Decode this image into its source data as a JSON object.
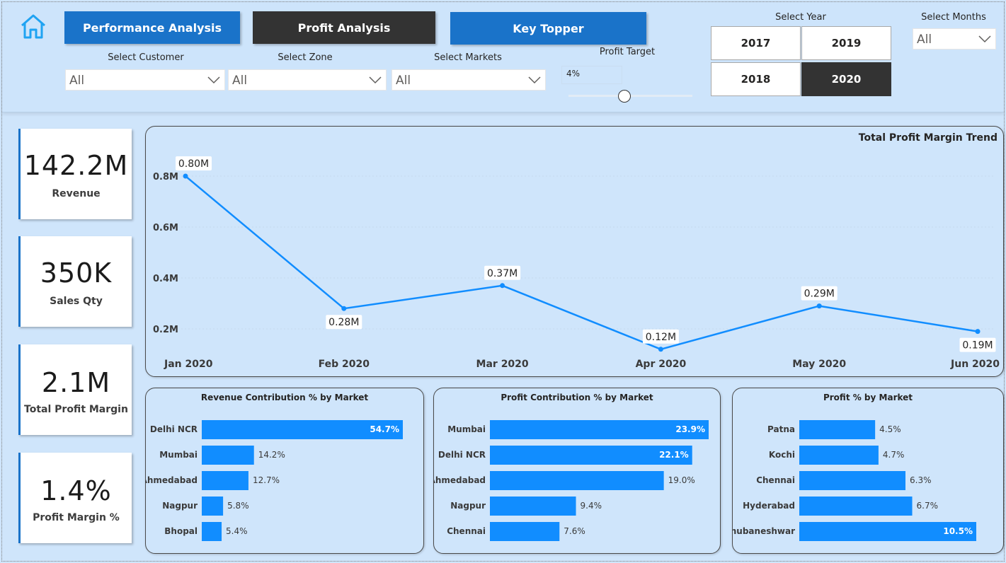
{
  "nav": {
    "performance_label": "Performance Analysis",
    "profit_label": "Profit Analysis",
    "topper_label": "Key Topper"
  },
  "filters": {
    "customer": {
      "label": "Select Customer",
      "value": "All"
    },
    "zone": {
      "label": "Select Zone",
      "value": "All"
    },
    "markets": {
      "label": "Select Markets",
      "value": "All"
    },
    "months": {
      "label": "Select Months",
      "value": "All"
    },
    "profit_target": {
      "label": "Profit Target",
      "value": "4%",
      "fraction": 0.45
    },
    "year": {
      "label": "Select Year",
      "options": [
        "2017",
        "2019",
        "2018",
        "2020"
      ],
      "selected": "2020"
    }
  },
  "kpis": [
    {
      "value": "142.2M",
      "label": "Revenue"
    },
    {
      "value": "350K",
      "label": "Sales Qty"
    },
    {
      "value": "2.1M",
      "label": "Total Profit Margin"
    },
    {
      "value": "1.4%",
      "label": "Profit Margin %"
    }
  ],
  "colors": {
    "accent": "#118dff",
    "nav_blue": "#1a73c9",
    "dark": "#333333",
    "background": "#cfe5fb"
  },
  "icons": {
    "home": "home-icon",
    "dropdown": "chevron-down-icon"
  },
  "chart_data": [
    {
      "type": "line",
      "title": "Total Profit Margin Trend",
      "x": [
        "Jan 2020",
        "Feb 2020",
        "Mar 2020",
        "Apr 2020",
        "May 2020",
        "Jun 2020"
      ],
      "values": [
        0.8,
        0.28,
        0.37,
        0.12,
        0.29,
        0.19
      ],
      "labels": [
        "0.80M",
        "0.28M",
        "0.37M",
        "0.12M",
        "0.29M",
        "0.19M"
      ],
      "yticks": [
        0.2,
        0.4,
        0.6,
        0.8
      ],
      "ytick_labels": [
        "0.2M",
        "0.4M",
        "0.6M",
        "0.8M"
      ],
      "ylim": [
        0.12,
        0.8
      ]
    },
    {
      "type": "bar",
      "title": "Revenue Contribution % by Market",
      "categories": [
        "Delhi NCR",
        "Mumbai",
        "Ahmedabad",
        "Nagpur",
        "Bhopal"
      ],
      "values": [
        54.7,
        14.2,
        12.7,
        5.8,
        5.4
      ],
      "labels": [
        "54.7%",
        "14.2%",
        "12.7%",
        "5.8%",
        "5.4%"
      ]
    },
    {
      "type": "bar",
      "title": "Profit Contribution % by Market",
      "categories": [
        "Mumbai",
        "Delhi NCR",
        "Ahmedabad",
        "Nagpur",
        "Chennai"
      ],
      "values": [
        23.9,
        22.1,
        19.0,
        9.4,
        7.6
      ],
      "labels": [
        "23.9%",
        "22.1%",
        "19.0%",
        "9.4%",
        "7.6%"
      ]
    },
    {
      "type": "bar",
      "title": "Profit % by Market",
      "categories": [
        "Patna",
        "Kochi",
        "Chennai",
        "Hyderabad",
        "Bhubaneshwar"
      ],
      "values": [
        4.5,
        4.7,
        6.3,
        6.7,
        10.5
      ],
      "labels": [
        "4.5%",
        "4.7%",
        "6.3%",
        "6.7%",
        "10.5%"
      ]
    }
  ]
}
